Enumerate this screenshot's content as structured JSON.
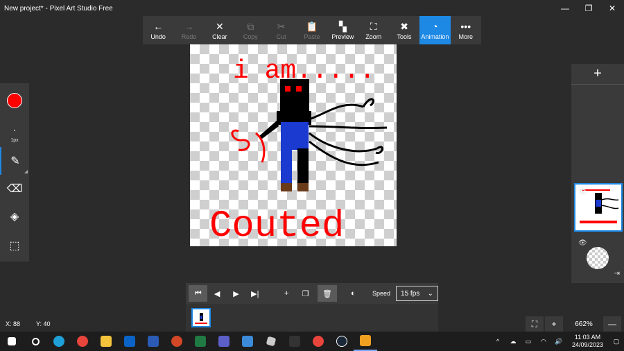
{
  "window": {
    "title": "New project* - Pixel Art Studio Free",
    "controls": [
      "—",
      "❐",
      "✕"
    ]
  },
  "toolbar": {
    "items": [
      {
        "label": "Undo",
        "icon": "←"
      },
      {
        "label": "Redo",
        "icon": "→"
      },
      {
        "label": "Clear",
        "icon": "✕"
      },
      {
        "label": "Copy",
        "icon": "⧉"
      },
      {
        "label": "Cut",
        "icon": "✂"
      },
      {
        "label": "Paste",
        "icon": "📋"
      },
      {
        "label": "Preview",
        "icon": "▚"
      },
      {
        "label": "Zoom",
        "icon": "⛶"
      },
      {
        "label": "Tools",
        "icon": "✖"
      },
      {
        "label": "Animation",
        "icon": "◔"
      },
      {
        "label": "More",
        "icon": "•••"
      }
    ]
  },
  "left_panel": {
    "brush_size": "1px",
    "current_color": "#ff0000"
  },
  "canvas": {
    "top_text": "i am.....",
    "bottom_text": "Couted"
  },
  "animation": {
    "speed_label": "Speed",
    "speed_value": "15 fps"
  },
  "status": {
    "x": "X: 88",
    "y": "Y: 40",
    "zoom": "662%"
  },
  "taskbar": {
    "time": "11:03 AM",
    "date": "24/09/2023"
  }
}
